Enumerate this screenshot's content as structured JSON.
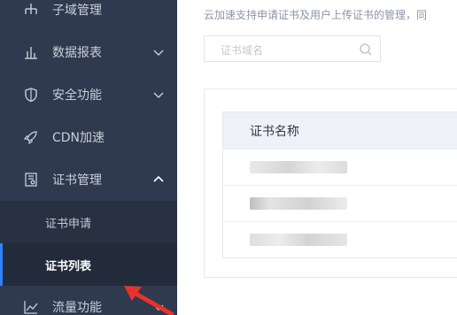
{
  "sidebar": {
    "items": [
      {
        "label": "子域管理",
        "icon": "hierarchy-icon"
      },
      {
        "label": "数据报表",
        "icon": "bar-chart-icon",
        "chevron": "down"
      },
      {
        "label": "安全功能",
        "icon": "shield-icon",
        "chevron": "down"
      },
      {
        "label": "CDN加速",
        "icon": "rocket-icon"
      },
      {
        "label": "证书管理",
        "icon": "certificate-icon",
        "chevron": "up"
      },
      {
        "label": "流量功能",
        "icon": "line-chart-icon",
        "chevron": "down"
      }
    ],
    "cert_sub": [
      {
        "label": "证书申请"
      },
      {
        "label": "证书列表",
        "active": true
      }
    ]
  },
  "main": {
    "description": "云加速支持申请证书及用户上传证书的管理，同",
    "search": {
      "placeholder": "证书域名"
    },
    "table": {
      "header": "证书名称",
      "rows": [
        "",
        "",
        ""
      ]
    }
  },
  "colors": {
    "sidebar_bg": "#2f3a4f",
    "active_accent": "#2f82ff",
    "annotation_arrow": "#e8322b"
  }
}
